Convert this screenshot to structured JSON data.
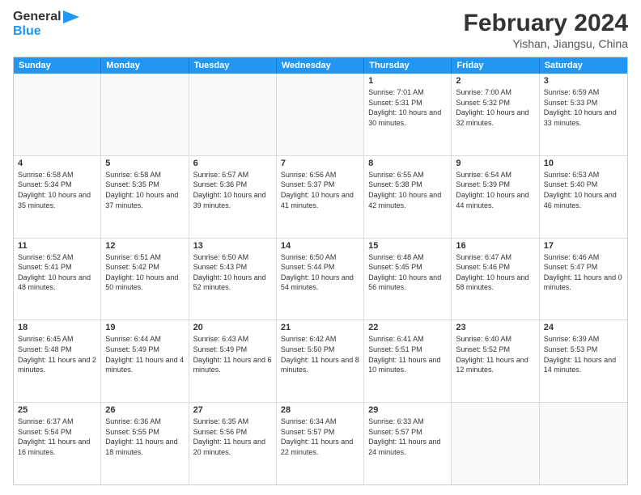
{
  "logo": {
    "line1": "General",
    "line2": "Blue"
  },
  "title": "February 2024",
  "subtitle": "Yishan, Jiangsu, China",
  "header_days": [
    "Sunday",
    "Monday",
    "Tuesday",
    "Wednesday",
    "Thursday",
    "Friday",
    "Saturday"
  ],
  "weeks": [
    [
      {
        "day": "",
        "info": ""
      },
      {
        "day": "",
        "info": ""
      },
      {
        "day": "",
        "info": ""
      },
      {
        "day": "",
        "info": ""
      },
      {
        "day": "1",
        "sunrise": "Sunrise: 7:01 AM",
        "sunset": "Sunset: 5:31 PM",
        "daylight": "Daylight: 10 hours and 30 minutes."
      },
      {
        "day": "2",
        "sunrise": "Sunrise: 7:00 AM",
        "sunset": "Sunset: 5:32 PM",
        "daylight": "Daylight: 10 hours and 32 minutes."
      },
      {
        "day": "3",
        "sunrise": "Sunrise: 6:59 AM",
        "sunset": "Sunset: 5:33 PM",
        "daylight": "Daylight: 10 hours and 33 minutes."
      }
    ],
    [
      {
        "day": "4",
        "sunrise": "Sunrise: 6:58 AM",
        "sunset": "Sunset: 5:34 PM",
        "daylight": "Daylight: 10 hours and 35 minutes."
      },
      {
        "day": "5",
        "sunrise": "Sunrise: 6:58 AM",
        "sunset": "Sunset: 5:35 PM",
        "daylight": "Daylight: 10 hours and 37 minutes."
      },
      {
        "day": "6",
        "sunrise": "Sunrise: 6:57 AM",
        "sunset": "Sunset: 5:36 PM",
        "daylight": "Daylight: 10 hours and 39 minutes."
      },
      {
        "day": "7",
        "sunrise": "Sunrise: 6:56 AM",
        "sunset": "Sunset: 5:37 PM",
        "daylight": "Daylight: 10 hours and 41 minutes."
      },
      {
        "day": "8",
        "sunrise": "Sunrise: 6:55 AM",
        "sunset": "Sunset: 5:38 PM",
        "daylight": "Daylight: 10 hours and 42 minutes."
      },
      {
        "day": "9",
        "sunrise": "Sunrise: 6:54 AM",
        "sunset": "Sunset: 5:39 PM",
        "daylight": "Daylight: 10 hours and 44 minutes."
      },
      {
        "day": "10",
        "sunrise": "Sunrise: 6:53 AM",
        "sunset": "Sunset: 5:40 PM",
        "daylight": "Daylight: 10 hours and 46 minutes."
      }
    ],
    [
      {
        "day": "11",
        "sunrise": "Sunrise: 6:52 AM",
        "sunset": "Sunset: 5:41 PM",
        "daylight": "Daylight: 10 hours and 48 minutes."
      },
      {
        "day": "12",
        "sunrise": "Sunrise: 6:51 AM",
        "sunset": "Sunset: 5:42 PM",
        "daylight": "Daylight: 10 hours and 50 minutes."
      },
      {
        "day": "13",
        "sunrise": "Sunrise: 6:50 AM",
        "sunset": "Sunset: 5:43 PM",
        "daylight": "Daylight: 10 hours and 52 minutes."
      },
      {
        "day": "14",
        "sunrise": "Sunrise: 6:50 AM",
        "sunset": "Sunset: 5:44 PM",
        "daylight": "Daylight: 10 hours and 54 minutes."
      },
      {
        "day": "15",
        "sunrise": "Sunrise: 6:48 AM",
        "sunset": "Sunset: 5:45 PM",
        "daylight": "Daylight: 10 hours and 56 minutes."
      },
      {
        "day": "16",
        "sunrise": "Sunrise: 6:47 AM",
        "sunset": "Sunset: 5:46 PM",
        "daylight": "Daylight: 10 hours and 58 minutes."
      },
      {
        "day": "17",
        "sunrise": "Sunrise: 6:46 AM",
        "sunset": "Sunset: 5:47 PM",
        "daylight": "Daylight: 11 hours and 0 minutes."
      }
    ],
    [
      {
        "day": "18",
        "sunrise": "Sunrise: 6:45 AM",
        "sunset": "Sunset: 5:48 PM",
        "daylight": "Daylight: 11 hours and 2 minutes."
      },
      {
        "day": "19",
        "sunrise": "Sunrise: 6:44 AM",
        "sunset": "Sunset: 5:49 PM",
        "daylight": "Daylight: 11 hours and 4 minutes."
      },
      {
        "day": "20",
        "sunrise": "Sunrise: 6:43 AM",
        "sunset": "Sunset: 5:49 PM",
        "daylight": "Daylight: 11 hours and 6 minutes."
      },
      {
        "day": "21",
        "sunrise": "Sunrise: 6:42 AM",
        "sunset": "Sunset: 5:50 PM",
        "daylight": "Daylight: 11 hours and 8 minutes."
      },
      {
        "day": "22",
        "sunrise": "Sunrise: 6:41 AM",
        "sunset": "Sunset: 5:51 PM",
        "daylight": "Daylight: 11 hours and 10 minutes."
      },
      {
        "day": "23",
        "sunrise": "Sunrise: 6:40 AM",
        "sunset": "Sunset: 5:52 PM",
        "daylight": "Daylight: 11 hours and 12 minutes."
      },
      {
        "day": "24",
        "sunrise": "Sunrise: 6:39 AM",
        "sunset": "Sunset: 5:53 PM",
        "daylight": "Daylight: 11 hours and 14 minutes."
      }
    ],
    [
      {
        "day": "25",
        "sunrise": "Sunrise: 6:37 AM",
        "sunset": "Sunset: 5:54 PM",
        "daylight": "Daylight: 11 hours and 16 minutes."
      },
      {
        "day": "26",
        "sunrise": "Sunrise: 6:36 AM",
        "sunset": "Sunset: 5:55 PM",
        "daylight": "Daylight: 11 hours and 18 minutes."
      },
      {
        "day": "27",
        "sunrise": "Sunrise: 6:35 AM",
        "sunset": "Sunset: 5:56 PM",
        "daylight": "Daylight: 11 hours and 20 minutes."
      },
      {
        "day": "28",
        "sunrise": "Sunrise: 6:34 AM",
        "sunset": "Sunset: 5:57 PM",
        "daylight": "Daylight: 11 hours and 22 minutes."
      },
      {
        "day": "29",
        "sunrise": "Sunrise: 6:33 AM",
        "sunset": "Sunset: 5:57 PM",
        "daylight": "Daylight: 11 hours and 24 minutes."
      },
      {
        "day": "",
        "info": ""
      },
      {
        "day": "",
        "info": ""
      }
    ]
  ]
}
